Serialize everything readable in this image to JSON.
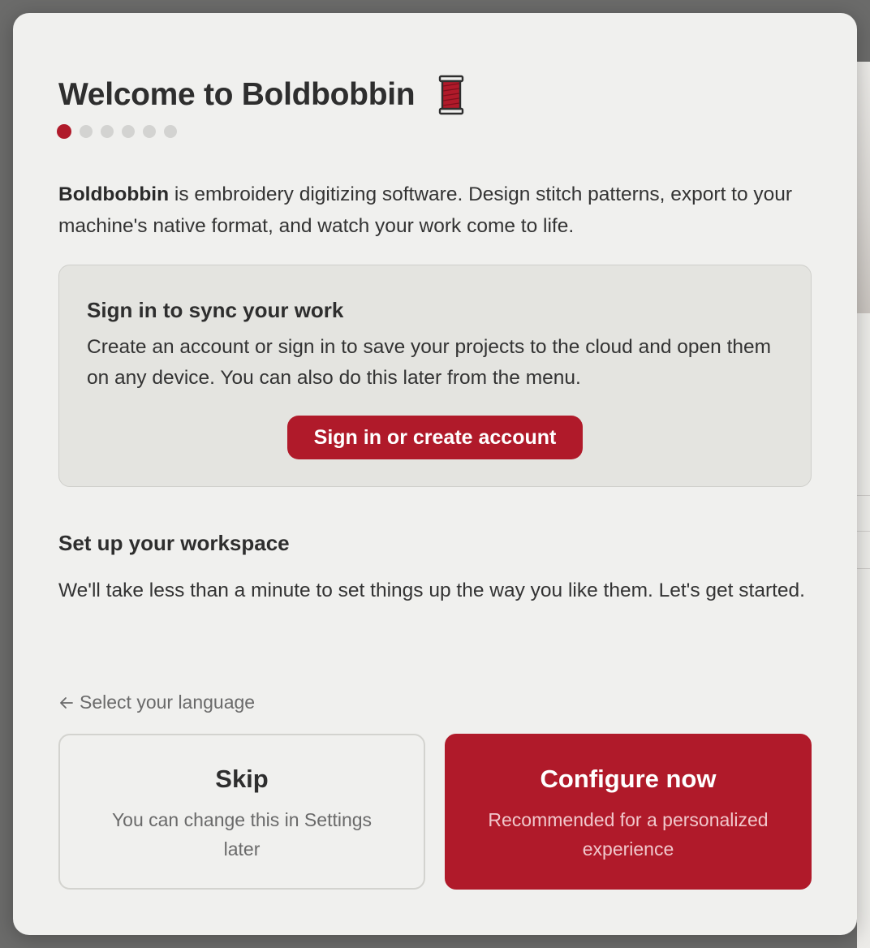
{
  "colors": {
    "accent": "#b01a2a",
    "modal_bg": "#f0f0ee",
    "card_bg": "#e4e4e0",
    "dot_inactive": "#d3d3d1"
  },
  "welcome": {
    "title": "Welcome to Boldbobbin",
    "title_icon": "thread-spool-icon",
    "steps": {
      "total": 6,
      "current": 1
    },
    "intro_brand": "Boldbobbin",
    "intro_rest": " is embroidery digitizing software. Design stitch patterns, export to your machine's native format, and watch your work come to life."
  },
  "signin": {
    "title": "Sign in to sync your work",
    "description": "Create an account or sign in to save your projects to the cloud and open them on any device. You can also do this later from the menu.",
    "button_label": "Sign in or create account"
  },
  "setup": {
    "title": "Set up your workspace",
    "description": "We'll take less than a minute to set things up the way you like them. Let's get started."
  },
  "navigation": {
    "back_icon": "arrow-left-icon",
    "back_label": "Select your language"
  },
  "choices": {
    "skip": {
      "title": "Skip",
      "subtitle": "You can change this in Settings later"
    },
    "configure": {
      "title": "Configure now",
      "subtitle": "Recommended for a personalized experience"
    }
  }
}
